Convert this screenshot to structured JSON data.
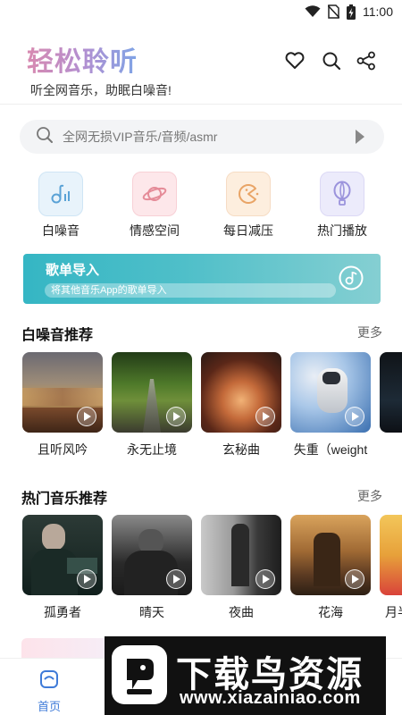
{
  "status": {
    "time": "11:00",
    "icons": [
      "wifi-icon",
      "no-sim-icon",
      "battery-charging-icon"
    ]
  },
  "header": {
    "title": "轻松聆听",
    "subtitle": "听全网音乐，助眠白噪音!",
    "title_gradient": [
      "#d88ab0",
      "#b48fd0",
      "#7fa4e6"
    ],
    "actions": [
      "heart-icon",
      "search-icon",
      "share-icon"
    ]
  },
  "search": {
    "placeholder": "全网无损VIP音乐/音频/asmr"
  },
  "quick_links": [
    {
      "label": "白噪音",
      "icon": "music-note-icon",
      "bg": "#e8f3fb",
      "color": "#5aa2d6"
    },
    {
      "label": "情感空间",
      "icon": "planet-icon",
      "bg": "#fde7ea",
      "color": "#e58b98"
    },
    {
      "label": "每日减压",
      "icon": "pacman-icon",
      "bg": "#fdeede",
      "color": "#e9a466"
    },
    {
      "label": "热门播放",
      "icon": "balloon-icon",
      "bg": "#ecebfb",
      "color": "#9b93dc"
    }
  ],
  "banner": {
    "title": "歌单导入",
    "subtitle": "将其他音乐App的歌单导入",
    "icon": "music-disc-icon"
  },
  "white_noise": {
    "title": "白噪音推荐",
    "more": "更多",
    "items": [
      {
        "label": "且听风吟",
        "palette": [
          "#6b6a72",
          "#b8945e",
          "#7a4a2c"
        ]
      },
      {
        "label": "永无止境",
        "palette": [
          "#2f4f1f",
          "#6f8f3a",
          "#3b3b2f"
        ]
      },
      {
        "label": "玄秘曲",
        "palette": [
          "#3b1c12",
          "#c46a3a",
          "#2a1a15"
        ]
      },
      {
        "label": "失重（weight",
        "palette": [
          "#3a6fb0",
          "#a9c7e8",
          "#e9eef5"
        ]
      },
      {
        "label": "",
        "palette": [
          "#101418",
          "#1d2a36",
          "#0d1015"
        ]
      }
    ]
  },
  "hot_music": {
    "title": "热门音乐推荐",
    "more": "更多",
    "items": [
      {
        "label": "孤勇者",
        "palette": [
          "#101f1c",
          "#3d5a52",
          "#1a2a26"
        ]
      },
      {
        "label": "晴天",
        "palette": [
          "#2a2a2a",
          "#8a8a8a",
          "#1a1a1a"
        ]
      },
      {
        "label": "夜曲",
        "palette": [
          "#1d1d1d",
          "#c9c9c9",
          "#3a3a3a"
        ]
      },
      {
        "label": "花海",
        "palette": [
          "#5b3a22",
          "#d9a35c",
          "#2d1f14"
        ]
      },
      {
        "label": "月半",
        "palette": [
          "#e7a13a",
          "#d9433a",
          "#f3c65a"
        ]
      }
    ]
  },
  "tabbar": {
    "home_label": "首页"
  },
  "watermark": {
    "title": "下载鸟资源",
    "url": "www.xiazainiao.com"
  }
}
